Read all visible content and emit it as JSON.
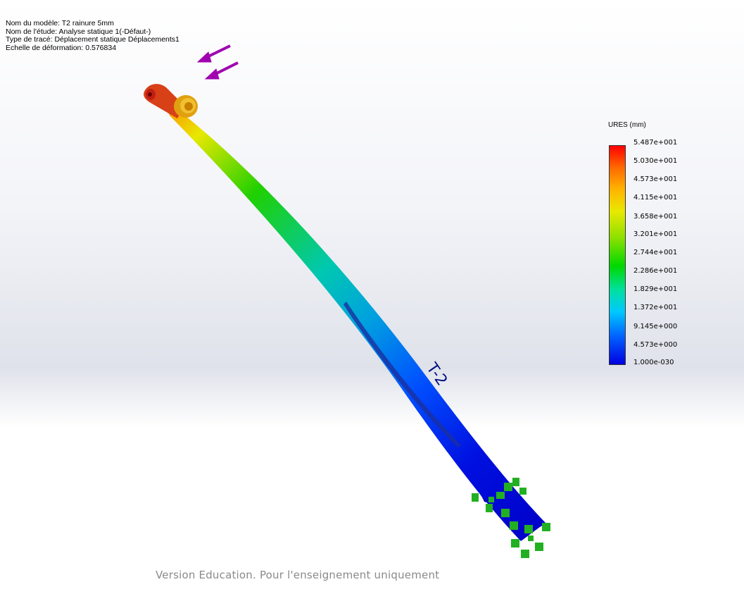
{
  "study_info": {
    "model_name": "Nom du modèle: T2 rainure 5mm",
    "study_name": "Nom de l'étude: Analyse statique 1(-Défaut-)",
    "plot_type": "Type de tracé: Déplacement statique Déplacements1",
    "deformation_scale": "Echelle de déformation: 0.576834"
  },
  "legend": {
    "title": "URES (mm)",
    "labels": [
      "5.487e+001",
      "5.030e+001",
      "4.573e+001",
      "4.115e+001",
      "3.658e+001",
      "3.201e+001",
      "2.744e+001",
      "2.286e+001",
      "1.829e+001",
      "1.372e+001",
      "9.145e+000",
      "4.573e+000",
      "1.000e-030"
    ],
    "colors": [
      "#ff0000",
      "#ff6a00",
      "#ffb400",
      "#e8e800",
      "#8ee000",
      "#00d800",
      "#00e0a0",
      "#00c8ff",
      "#0064ff",
      "#0000e0"
    ]
  },
  "model": {
    "engraving": "T-2",
    "load_arrow_color": "#a000b0",
    "fixture_color": "#22b022"
  },
  "watermark": "Version Education. Pour l'enseignement uniquement"
}
